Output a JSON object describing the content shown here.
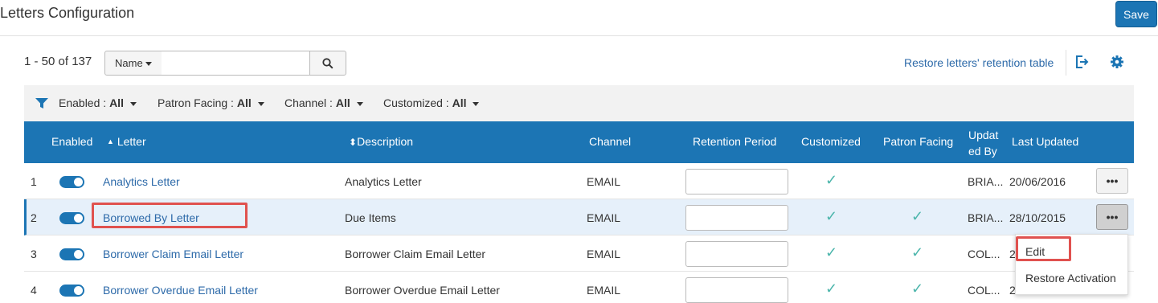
{
  "header": {
    "title": "Letters Configuration",
    "save_label": "Save"
  },
  "toolbar": {
    "count_text": "1 - 50 of 137",
    "search_field": "Name",
    "search_value": "",
    "search_icon": "magnifier-icon",
    "restore_link": "Restore letters' retention table",
    "export_icon": "export-icon",
    "settings_icon": "gear-icon"
  },
  "filters": [
    {
      "label": "Enabled :",
      "value": "All"
    },
    {
      "label": "Patron Facing :",
      "value": "All"
    },
    {
      "label": "Channel :",
      "value": "All"
    },
    {
      "label": "Customized :",
      "value": "All"
    }
  ],
  "table": {
    "columns": {
      "enabled": "Enabled",
      "letter": "Letter",
      "description": "Description",
      "channel": "Channel",
      "retention": "Retention Period",
      "customized": "Customized",
      "patron_facing": "Patron Facing",
      "updated_by_1": "Updat",
      "updated_by_2": "ed By",
      "last_updated": "Last Updated"
    },
    "sort_up_glyph": "▲",
    "sort_both_glyph": "⬍",
    "check_glyph": "✓",
    "more_glyph": "•••",
    "rows": [
      {
        "num": "1",
        "letter": "Analytics Letter",
        "description": "Analytics Letter",
        "channel": "EMAIL",
        "customized": "✓",
        "patron_facing": "",
        "updated_by": "BRIA...",
        "last_updated": "20/06/2016"
      },
      {
        "num": "2",
        "letter": "Borrowed By Letter",
        "description": "Due Items",
        "channel": "EMAIL",
        "customized": "✓",
        "patron_facing": "✓",
        "updated_by": "BRIA...",
        "last_updated": "28/10/2015"
      },
      {
        "num": "3",
        "letter": "Borrower Claim Email Letter",
        "description": "Borrower Claim Email Letter",
        "channel": "EMAIL",
        "customized": "✓",
        "patron_facing": "✓",
        "updated_by": "COL...",
        "last_updated": "2"
      },
      {
        "num": "4",
        "letter": "Borrower Overdue Email Letter",
        "description": "Borrower Overdue Email Letter",
        "channel": "EMAIL",
        "customized": "✓",
        "patron_facing": "✓",
        "updated_by": "COL...",
        "last_updated": "2"
      }
    ]
  },
  "row_menu": {
    "edit": "Edit",
    "restore": "Restore Activation"
  },
  "colors": {
    "primary": "#1c75b4",
    "link": "#2d6aa9",
    "check": "#4db6ac",
    "highlight": "#e0524f"
  }
}
